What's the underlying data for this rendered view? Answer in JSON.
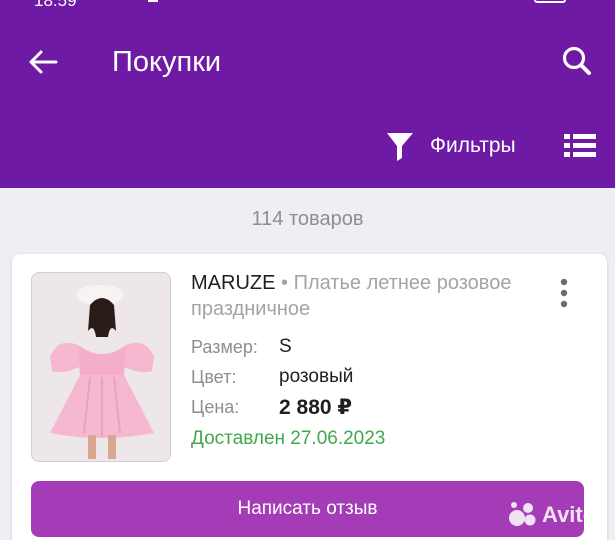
{
  "status_bar": {
    "time": "18:59"
  },
  "header": {
    "title": "Покупки",
    "filters_label": "Фильтры"
  },
  "list": {
    "count_text": "114 товаров"
  },
  "item": {
    "brand": "MARUZE",
    "separator": " • ",
    "name": "Платье летнее розовое праздничное",
    "fields": [
      {
        "key": "Размер:",
        "value": "S"
      },
      {
        "key": "Цвет:",
        "value": "розовый"
      },
      {
        "key": "Цена:",
        "value": "2 880 ₽"
      }
    ],
    "delivery": "Доставлен 27.06.2023",
    "review_button": "Написать отзыв"
  },
  "watermark": {
    "text": "Avito"
  },
  "colors": {
    "appbar": "#6f1aa5",
    "button": "#a43cb8",
    "delivered": "#3fa84b",
    "dress": "#f6b8d0"
  },
  "icons": [
    "back-arrow-icon",
    "search-icon",
    "filter-funnel-icon",
    "list-view-icon",
    "more-vert-icon"
  ]
}
